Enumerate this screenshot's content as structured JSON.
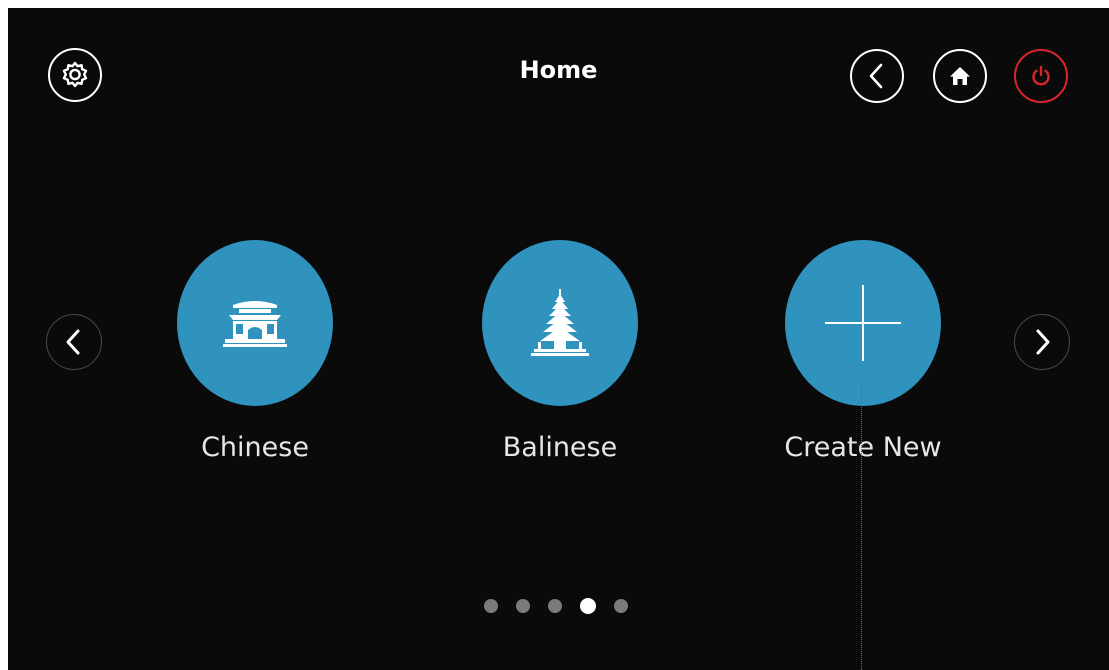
{
  "header": {
    "title": "Home",
    "settings_icon": "gear-icon",
    "back_icon": "chevron-left-icon",
    "home_icon": "home-icon",
    "power_icon": "power-icon"
  },
  "tiles": [
    {
      "label": "Chinese",
      "icon": "chinese-gate-icon"
    },
    {
      "label": "Balinese",
      "icon": "balinese-pagoda-icon"
    },
    {
      "label": "Create New",
      "icon": "plus-icon"
    }
  ],
  "pagination": {
    "count": 5,
    "active_index": 3
  },
  "colors": {
    "background": "#0b0a0a",
    "accent": "#2f93bd",
    "power": "#d8262c",
    "dot_inactive": "#7a7a7a",
    "dot_active": "#ffffff"
  }
}
